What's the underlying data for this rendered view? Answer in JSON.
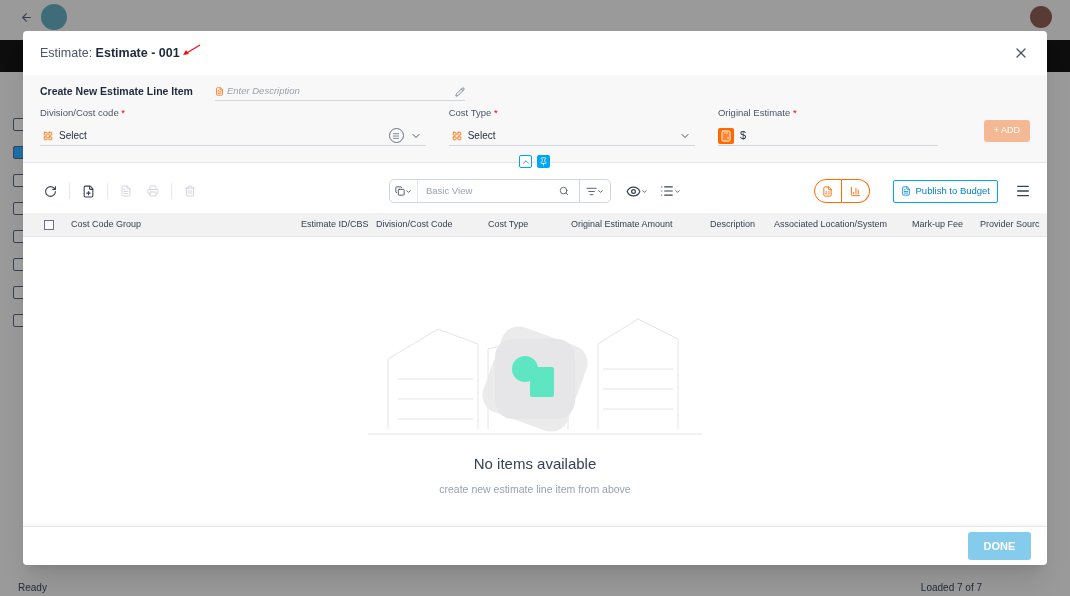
{
  "background": {
    "rows": [
      {
        "checked": false
      },
      {
        "checked": true
      },
      {
        "checked": false
      },
      {
        "checked": false
      },
      {
        "checked": false
      },
      {
        "checked": false
      },
      {
        "checked": false
      },
      {
        "checked": false
      }
    ],
    "status_bar": {
      "left": "Ready",
      "right": "Loaded 7 of 7"
    }
  },
  "dialog": {
    "title_label": "Estimate:",
    "title_value": "Estimate - 001",
    "form": {
      "heading": "Create New Estimate Line Item",
      "description": {
        "placeholder": "Enter Description"
      },
      "fields": [
        {
          "kind": "select",
          "label": "Division/Cost code",
          "required_mark": "*",
          "value": "Select",
          "list_button": true
        },
        {
          "kind": "select",
          "label": "Cost Type",
          "required_mark": "*",
          "value": "Select"
        },
        {
          "kind": "money",
          "label": "Original Estimate",
          "required_mark": "*",
          "value": "$"
        }
      ],
      "add_button": {
        "label": "+ ADD",
        "disabled": true
      }
    },
    "toolbar": {
      "view": {
        "placeholder": "Basic View"
      },
      "publish_button": "Publish to Budget"
    },
    "table": {
      "select_all": {
        "checked": false
      },
      "columns": [
        "Cost Code Group",
        "Estimate ID/CBS",
        "Division/Cost Code",
        "Cost Type",
        "Original Estimate Amount",
        "Description",
        "Associated Location/System",
        "Mark-up Fee",
        "Provider Sourc"
      ]
    },
    "empty_state": {
      "title": "No items available",
      "subtitle": "create new estimate line item from above"
    },
    "done_button": {
      "label": "DONE",
      "disabled": true
    }
  }
}
